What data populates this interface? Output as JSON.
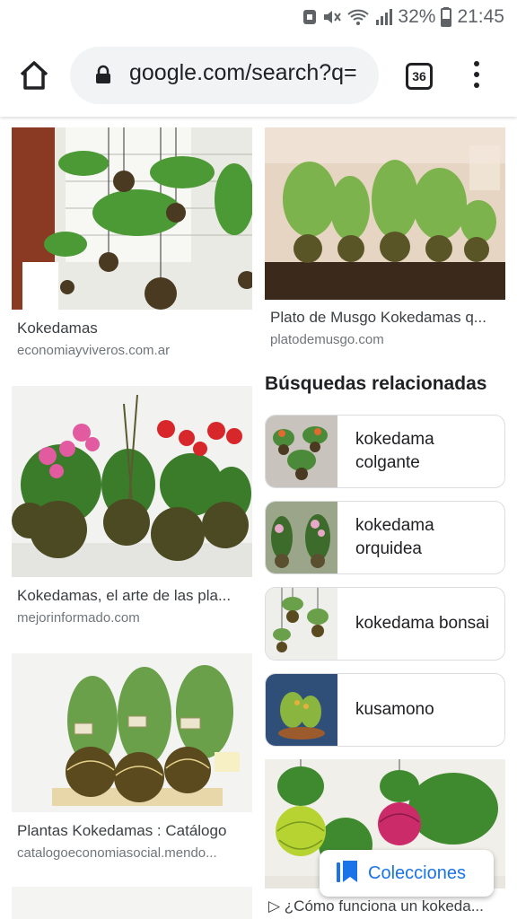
{
  "status_bar": {
    "battery": "32%",
    "time": "21:45"
  },
  "toolbar": {
    "url": "google.com/search?q=",
    "tab_count": "36"
  },
  "results_left": [
    {
      "title": "Kokedamas",
      "source": "economiayviveros.com.ar"
    },
    {
      "title": "Kokedamas, el arte de las pla...",
      "source": "mejorinformado.com"
    },
    {
      "title": "Plantas Kokedamas : Catálogo",
      "source": "catalogoeconomiasocial.mendo..."
    }
  ],
  "results_right": [
    {
      "title": "Plato de Musgo Kokedamas q...",
      "source": "platodemusgo.com"
    },
    {
      "title": "▷ ¿Cómo funciona un kokeda..."
    }
  ],
  "related": {
    "heading": "Búsquedas relacionadas",
    "items": [
      {
        "label": "kokedama colgante"
      },
      {
        "label": "kokedama orquidea"
      },
      {
        "label": "kokedama bonsai"
      },
      {
        "label": "kusamono"
      }
    ]
  },
  "collections_button": {
    "label": "Colecciones"
  },
  "colors": {
    "accent": "#1a73e8",
    "moss": "#5b6b2e",
    "leaf": "#3f8a2e"
  }
}
